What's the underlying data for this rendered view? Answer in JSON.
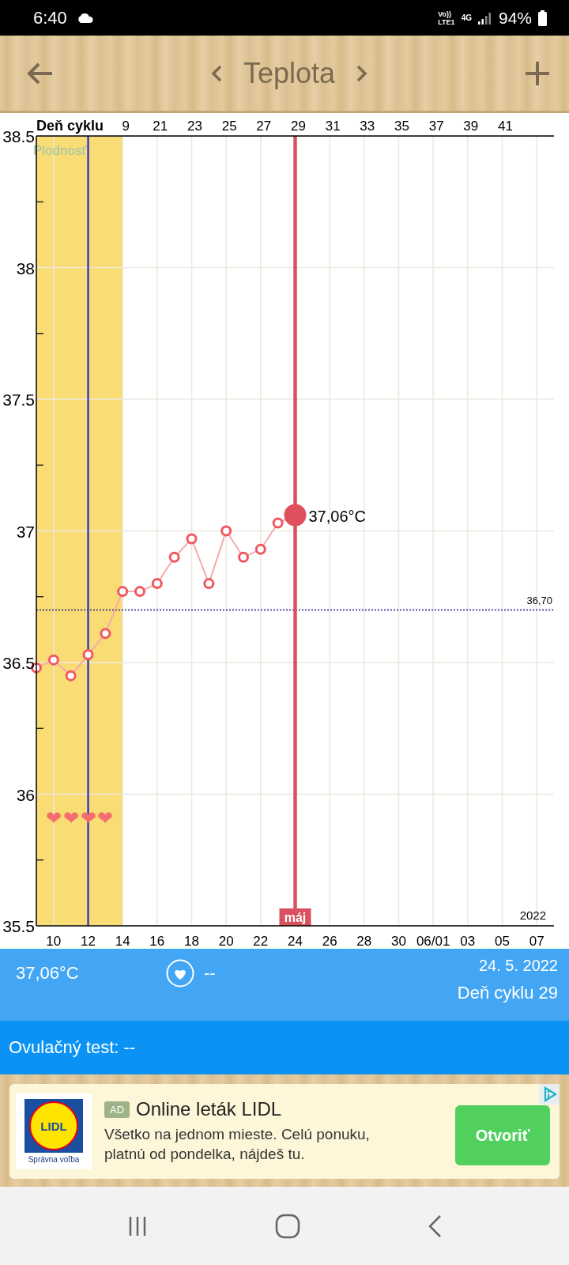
{
  "status_bar": {
    "time": "6:40",
    "volte": "Vo))",
    "lte": "LTE1",
    "network": "4G",
    "battery": "94%"
  },
  "header": {
    "title": "Teplota"
  },
  "chart": {
    "top_axis_label": "Deň cyklu",
    "top_ticks": [
      "9",
      "21",
      "23",
      "25",
      "27",
      "29",
      "31",
      "33",
      "35",
      "37",
      "39",
      "41"
    ],
    "intercourse_marks": [
      "❤",
      "❤",
      "❤",
      "❤"
    ],
    "year": "2022",
    "chart_data": {
      "type": "line",
      "grid": true,
      "x": [
        "2022-05-09",
        "2022-05-10",
        "2022-05-11",
        "2022-05-12",
        "2022-05-13",
        "2022-05-14",
        "2022-05-15",
        "2022-05-16",
        "2022-05-17",
        "2022-05-18",
        "2022-05-19",
        "2022-05-20",
        "2022-05-21",
        "2022-05-22",
        "2022-05-23",
        "2022-05-24"
      ],
      "series": [
        {
          "color": "#f0585f",
          "marker": "o",
          "values": [
            36.48,
            36.51,
            36.45,
            36.53,
            36.61,
            36.77,
            36.77,
            36.8,
            36.9,
            36.97,
            36.8,
            37.0,
            36.9,
            36.93,
            37.03,
            37.06
          ]
        }
      ],
      "xlim": [
        "2022-05-09",
        "2022-06-08"
      ],
      "ylim": [
        35.5,
        38.5
      ],
      "xticks": [
        {
          "value": "2022-05-10",
          "label": "10"
        },
        {
          "value": "2022-05-12",
          "label": "12"
        },
        {
          "value": "2022-05-14",
          "label": "14"
        },
        {
          "value": "2022-05-16",
          "label": "16"
        },
        {
          "value": "2022-05-18",
          "label": "18"
        },
        {
          "value": "2022-05-20",
          "label": "20"
        },
        {
          "value": "2022-05-22",
          "label": "22"
        },
        {
          "value": "2022-05-24",
          "label": "24"
        },
        {
          "value": "2022-05-26",
          "label": "26"
        },
        {
          "value": "2022-05-28",
          "label": "28"
        },
        {
          "value": "2022-05-30",
          "label": "30"
        },
        {
          "value": "2022-06-01",
          "label": "06/01"
        },
        {
          "value": "2022-06-03",
          "label": "03"
        },
        {
          "value": "2022-06-05",
          "label": "05"
        },
        {
          "value": "2022-06-07",
          "label": "07"
        }
      ],
      "yticks": [
        {
          "value": 35.5,
          "label": "35.5"
        },
        {
          "value": 36,
          "label": "36"
        },
        {
          "value": 36.5,
          "label": "36.5"
        },
        {
          "value": 37,
          "label": "37"
        },
        {
          "value": 37.5,
          "label": "37.5"
        },
        {
          "value": 38,
          "label": "38"
        },
        {
          "value": 38.5,
          "label": "38.5"
        }
      ],
      "bands": [
        {
          "axis": "x",
          "from": "2022-05-09",
          "to": "2022-05-14",
          "color": "#f9dc74",
          "label": "Plodnosť"
        }
      ],
      "ref_lines": [
        {
          "axis": "x",
          "value": "2022-05-12",
          "color": "#2626c4"
        },
        {
          "axis": "x",
          "value": "2022-05-24",
          "color": "#d9505e",
          "label": "máj"
        },
        {
          "axis": "y",
          "value": 36.7,
          "color": "#1d1d8a",
          "label": "36,70"
        }
      ],
      "annotations": [
        {
          "x": "2022-05-24",
          "y": 37.06,
          "text": "37,06°C"
        }
      ]
    }
  },
  "summary": {
    "temperature": "37,06°C",
    "intercourse": "--",
    "date": "24. 5. 2022",
    "cycle_day": "Deň cyklu 29"
  },
  "ovulation_test": {
    "label": "Ovulačný test:",
    "value": "--"
  },
  "ad": {
    "logo_text": "LIDL",
    "logo_caption": "Správna voľba",
    "badge": "AD",
    "title": "Online leták LIDL",
    "body": "Všetko na jednom mieste. Celú ponuku, platnú od pondelka, nájdeš tu.",
    "button": "Otvoriť"
  }
}
